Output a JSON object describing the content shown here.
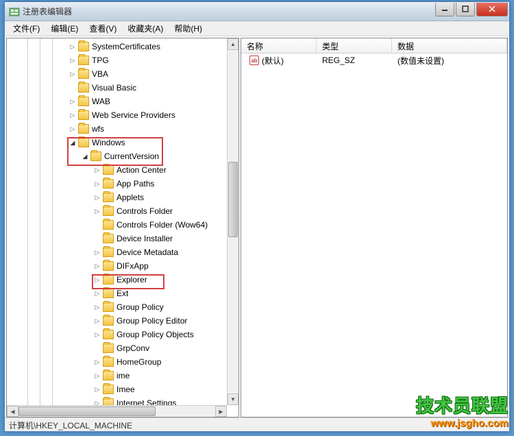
{
  "window": {
    "title": "注册表编辑器"
  },
  "menu": {
    "file": "文件(F)",
    "edit": "编辑(E)",
    "view": "查看(V)",
    "favorites": "收藏夹(A)",
    "help": "帮助(H)"
  },
  "tree": {
    "top_items": [
      {
        "label": "SystemCertificates",
        "indent": 90,
        "exp": "▷"
      },
      {
        "label": "TPG",
        "indent": 90,
        "exp": "▷"
      },
      {
        "label": "VBA",
        "indent": 90,
        "exp": "▷"
      },
      {
        "label": "Visual Basic",
        "indent": 90,
        "exp": ""
      },
      {
        "label": "WAB",
        "indent": 90,
        "exp": "▷"
      },
      {
        "label": "Web Service Providers",
        "indent": 90,
        "exp": "▷"
      },
      {
        "label": "wfs",
        "indent": 90,
        "exp": "▷"
      },
      {
        "label": "Windows",
        "indent": 90,
        "exp": "◢"
      },
      {
        "label": "CurrentVersion",
        "indent": 108,
        "exp": "◢"
      },
      {
        "label": "Action Center",
        "indent": 126,
        "exp": "▷"
      },
      {
        "label": "App Paths",
        "indent": 126,
        "exp": "▷"
      },
      {
        "label": "Applets",
        "indent": 126,
        "exp": "▷"
      },
      {
        "label": "Controls Folder",
        "indent": 126,
        "exp": "▷"
      },
      {
        "label": "Controls Folder (Wow64)",
        "indent": 126,
        "exp": ""
      },
      {
        "label": "Device Installer",
        "indent": 126,
        "exp": ""
      },
      {
        "label": "Device Metadata",
        "indent": 126,
        "exp": "▷"
      },
      {
        "label": "DIFxApp",
        "indent": 126,
        "exp": "▷"
      },
      {
        "label": "Explorer",
        "indent": 126,
        "exp": "▷"
      },
      {
        "label": "Ext",
        "indent": 126,
        "exp": "▷"
      },
      {
        "label": "Group Policy",
        "indent": 126,
        "exp": "▷"
      },
      {
        "label": "Group Policy Editor",
        "indent": 126,
        "exp": "▷"
      },
      {
        "label": "Group Policy Objects",
        "indent": 126,
        "exp": "▷"
      },
      {
        "label": "GrpConv",
        "indent": 126,
        "exp": ""
      },
      {
        "label": "HomeGroup",
        "indent": 126,
        "exp": "▷"
      },
      {
        "label": "ime",
        "indent": 126,
        "exp": "▷"
      },
      {
        "label": "Imee",
        "indent": 126,
        "exp": "▷"
      },
      {
        "label": "Internet Settings",
        "indent": 126,
        "exp": "▷"
      }
    ]
  },
  "list": {
    "columns": {
      "name": "名称",
      "type": "类型",
      "data": "数据"
    },
    "row": {
      "name": "(默认)",
      "type": "REG_SZ",
      "data": "(数值未设置)"
    }
  },
  "statusbar": {
    "path": "计算机\\HKEY_LOCAL_MACHINE"
  },
  "watermark": {
    "line1": "技术员联盟",
    "line2": "www.jsgho.com"
  }
}
